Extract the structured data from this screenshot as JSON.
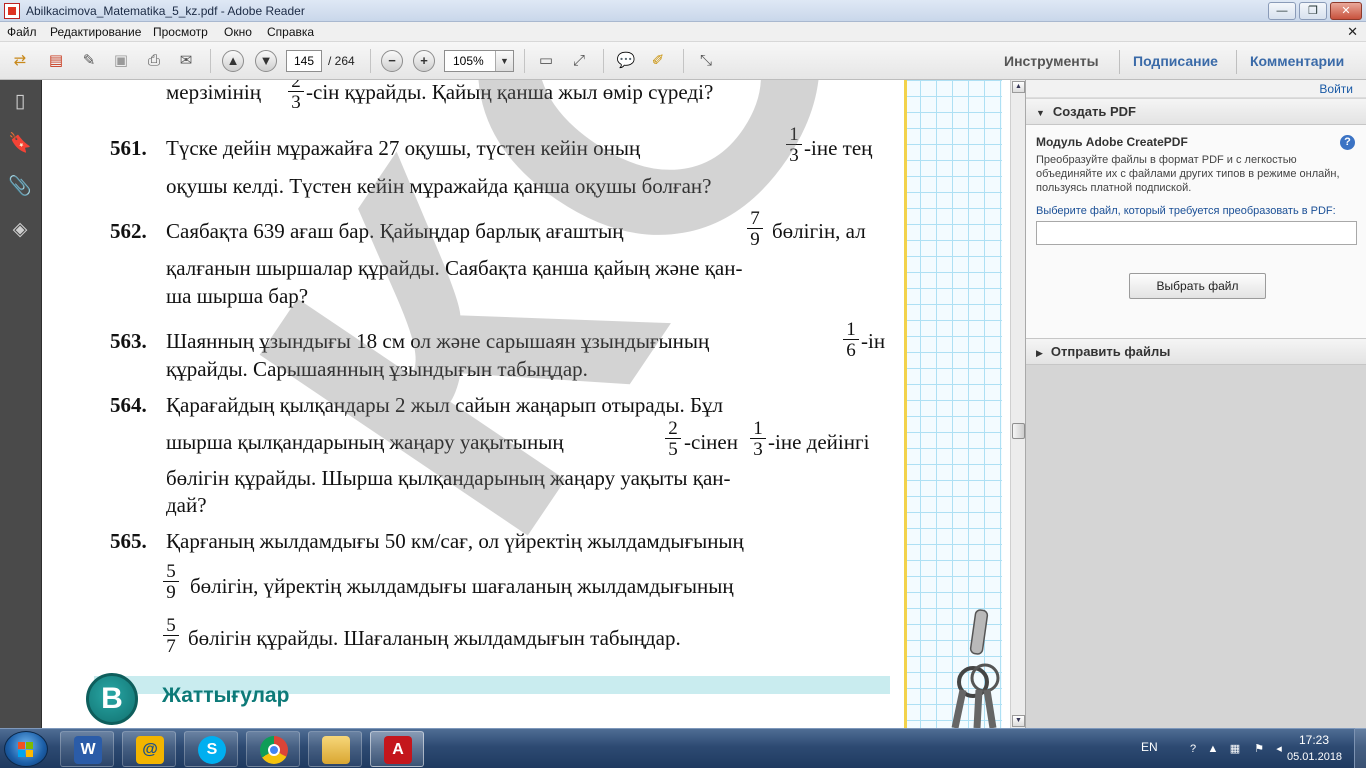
{
  "window": {
    "title": "Abilkacimova_Matematika_5_kz.pdf - Adobe Reader",
    "min_label": "—",
    "max_label": "❐",
    "close_label": "✕"
  },
  "menu": [
    "Файл",
    "Редактирование",
    "Просмотр",
    "Окно",
    "Справка"
  ],
  "toolbar": {
    "current_page": "145",
    "page_total": "/ 264",
    "zoom": "105%",
    "tools_label": "Инструменты",
    "sign_label": "Подписание",
    "comment_label": "Комментарии"
  },
  "document": {
    "watermark": "КОПИЯ",
    "top_line": "мерзімінің",
    "top_frac": {
      "n": "2",
      "d": "3"
    },
    "top_line_tail": "-сін құрайды. Қайың қанша жыл өмір сүреді?",
    "problems": [
      {
        "num": "561.",
        "lines": [
          "Түске дейін мұражайға 27 оқушы, түстен кейін оның",
          "-іне тең",
          "оқушы келді. Түстен кейін мұражайда қанша оқушы болған?"
        ],
        "fracs": [
          {
            "n": "1",
            "d": "3"
          }
        ]
      },
      {
        "num": "562.",
        "lines": [
          "Саябақта 639 ағаш бар. Қайыңдар барлық ағаштың",
          "бөлігін, ал",
          "қалғанын шыршалар құрайды. Саябақта қанша қайың және қан-",
          "ша шырша бар?"
        ],
        "fracs": [
          {
            "n": "7",
            "d": "9"
          }
        ]
      },
      {
        "num": "563.",
        "lines": [
          "Шаянның ұзындығы 18 см ол және сарышаян ұзындығының",
          "-ін",
          "құрайды. Сарышаянның ұзындығын  табыңдар."
        ],
        "fracs": [
          {
            "n": "1",
            "d": "6"
          }
        ]
      },
      {
        "num": "564.",
        "lines": [
          "Қарағайдың қылқандары 2 жыл сайын жаңарып отырады. Бұл",
          "шырша қылқандарының жаңару уақытының",
          "-сінен",
          "-іне дейінгі",
          "бөлігін құрайды. Шырша қылқандарының жаңару уақыты қан-",
          "дай?"
        ],
        "fracs": [
          {
            "n": "2",
            "d": "5"
          },
          {
            "n": "1",
            "d": "3"
          }
        ]
      },
      {
        "num": "565.",
        "lines": [
          "Қарғаның жылдамдығы 50 км/сағ, ол үйректің жылдамдығының",
          "бөлігін, үйректің жылдамдығы шағаланың жылдамдығының",
          "бөлігін құрайды. Шағаланың жылдамдығын табыңдар."
        ],
        "fracs": [
          {
            "n": "5",
            "d": "9"
          },
          {
            "n": "5",
            "d": "7"
          }
        ]
      }
    ],
    "section_letter": "B",
    "section_title": "Жаттығулар"
  },
  "right_pane": {
    "signin": "Войти",
    "create_pdf": {
      "header": "Создать PDF",
      "title": "Модуль Adobe CreatePDF",
      "help": "?",
      "description": "Преобразуйте файлы в формат PDF и с легкостью объединяйте их с файлами других типов в режиме онлайн, пользуясь платной подпиской.",
      "file_label": "Выберите файл, который требуется преобразовать в PDF:",
      "button": "Выбрать файл"
    },
    "send_files": {
      "header": "Отправить файлы"
    }
  },
  "taskbar": {
    "apps": [
      "Microsoft Word",
      "Mail",
      "Skype",
      "Google Chrome",
      "Windows Explorer",
      "Adobe Reader"
    ],
    "app_glyphs": [
      "W",
      "@",
      "S",
      "",
      "",
      "A"
    ],
    "language": "EN",
    "time": "17:23",
    "date": "05.01.2018"
  },
  "colors": {
    "accent_blue": "#3a6aa8",
    "section_teal": "#0d7a78",
    "grid_blue": "#aee0f4"
  },
  "icons": [
    "back-forward-icon",
    "create-pdf-icon",
    "edit-icon",
    "save-icon",
    "print-icon",
    "email-icon",
    "page-up-icon",
    "page-down-icon",
    "zoom-out-icon",
    "zoom-in-icon",
    "fit-page-icon",
    "fit-width-icon",
    "comment-icon",
    "highlight-icon",
    "fullscreen-icon",
    "pages-icon",
    "bookmarks-icon",
    "attachments-icon",
    "layers-icon"
  ]
}
